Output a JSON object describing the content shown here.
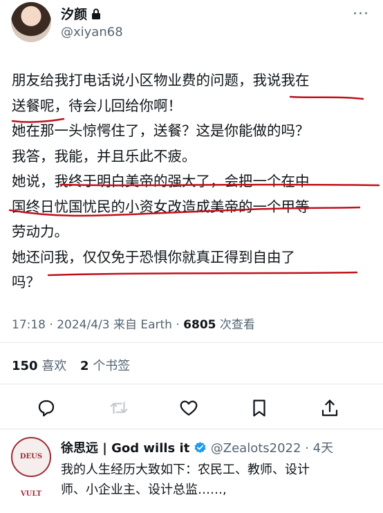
{
  "tweet": {
    "author_name": "汐颜",
    "handle": "@xiyan68",
    "lines": [
      "朋友给我打电话说小区物业费的问题，我说我在",
      "送餐呢，待会儿回给你啊！",
      "她在那一头惊愕住了，送餐？这是你能做的吗？",
      "我答，我能，并且乐此不疲。",
      "她说，我终于明白美帝的强大了，会把一个在中",
      "国终日忧国忧民的小资女改造成美帝的一个甲等",
      "劳动力。",
      "她还问我，仅仅免于恐惧你就真正得到自由了",
      "吗？"
    ],
    "time": "17:18 · 2024/4/3 来自 Earth · ",
    "views": "6805",
    "views_label": " 次查看"
  },
  "stats": {
    "likes_count": "150",
    "likes_label": "喜欢",
    "bookmarks_count": "2",
    "bookmarks_label": "个书签"
  },
  "actions": {
    "icons": [
      "reply-icon",
      "retweet-icon",
      "like-icon",
      "bookmark-icon",
      "share-icon"
    ]
  },
  "reply": {
    "avatar_text": "DEUS VULT",
    "author_name": "徐思远 | God wills it",
    "handle_time": "@Zealots2022 · 4天",
    "lines": [
      "我的人生经历大致如下：农民工、教师、设计",
      "师、小企业主、设计总监……,"
    ]
  },
  "colors": {
    "text": "#0f1419",
    "secondary": "#536471",
    "verified": "#1d9bf0",
    "annotation": "#c0101a"
  }
}
